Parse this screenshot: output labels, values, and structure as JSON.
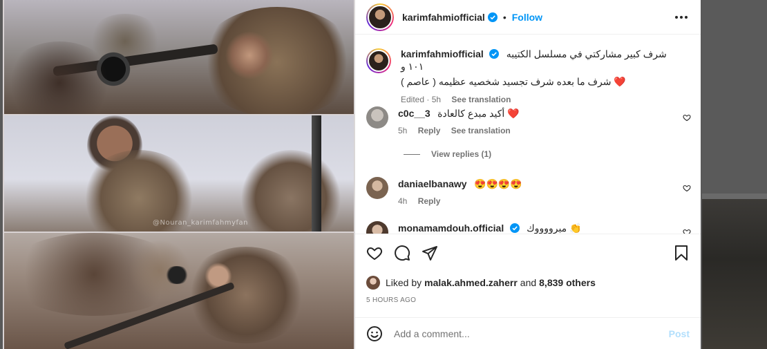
{
  "post": {
    "username": "karimfahmiofficial",
    "follow_label": "Follow",
    "separator": "•",
    "more_label": "More options",
    "watermark": "@Nouran_karimfahmyfan"
  },
  "caption": {
    "username": "karimfahmiofficial",
    "line1": "شرف كبير مشاركتي في مسلسل الكتيبه ١٠١ و",
    "line2": "شرف ما بعده شرف تجسيد شخصيه عظيمه ( عاصم ) ❤️",
    "edited": "Edited · 5h",
    "see_translation": "See translation"
  },
  "comments": [
    {
      "username": "c0c__3",
      "text": "أكيد مبدع كالعادة ❤️",
      "time": "5h",
      "reply": "Reply",
      "see_translation": "See translation"
    },
    {
      "username": "daniaelbanawy",
      "text": "😍😍😍😍",
      "time": "4h",
      "reply": "Reply"
    },
    {
      "username": "monamamdouh.official",
      "text": "مبرووووك 👏"
    }
  ],
  "view_replies": "View replies (1)",
  "likes": {
    "prefix": "Liked by ",
    "user": "malak.ahmed.zaherr",
    "middle": " and ",
    "count": "8,839 others"
  },
  "timestamp": "5 HOURS AGO",
  "composer": {
    "placeholder": "Add a comment...",
    "post_label": "Post"
  },
  "colors": {
    "accent": "#0095f6",
    "post_disabled": "#b2dffc",
    "like_heart": "#ed4956"
  }
}
